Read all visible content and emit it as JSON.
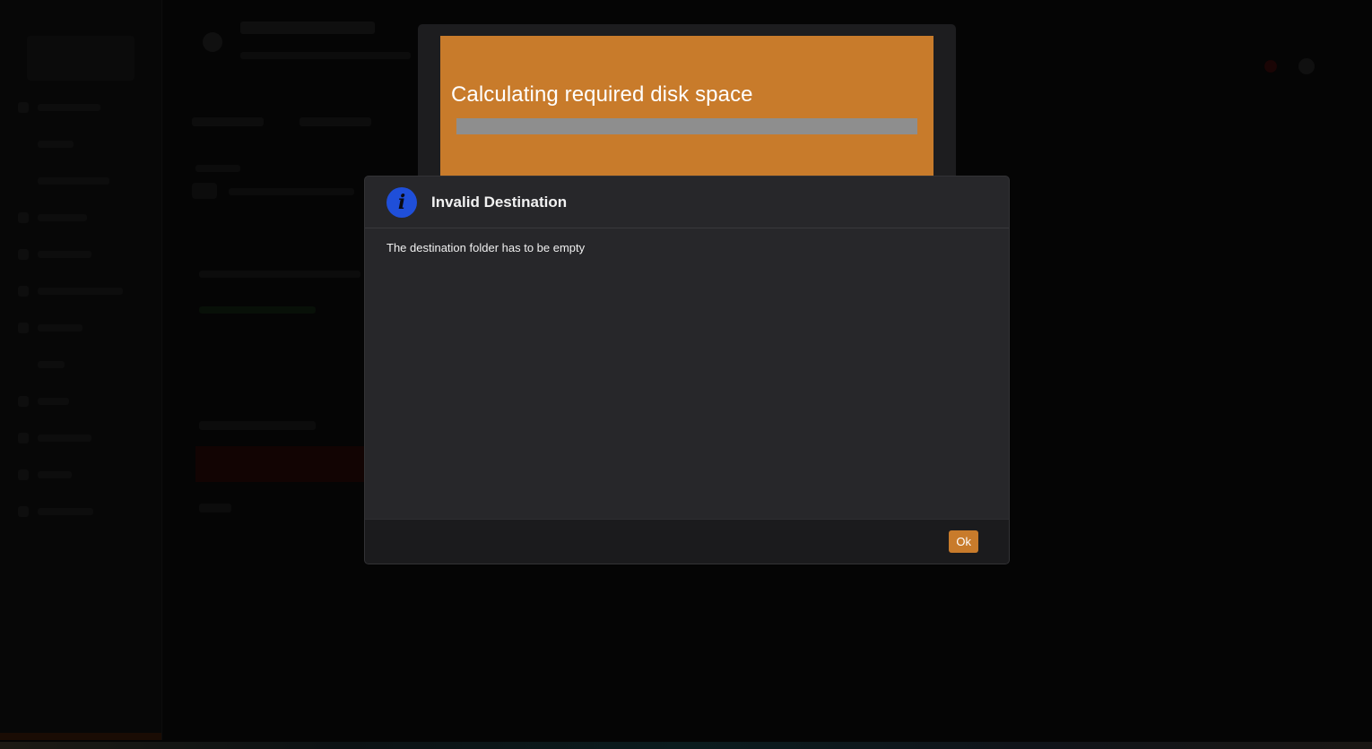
{
  "progress": {
    "title": "Calculating required disk space",
    "fraction": 0
  },
  "dialog": {
    "title": "Invalid Destination",
    "icon": "info-icon",
    "icon_glyph": "i",
    "message": "The destination folder has to be empty",
    "ok_label": "Ok"
  },
  "colors": {
    "accent": "#c87b2b",
    "info_icon": "#1f4fd9",
    "dialog_background": "#27272a",
    "dialog_footer": "#1b1b1d",
    "progress_track": "#8e8e8e",
    "backdrop": "#050505"
  }
}
